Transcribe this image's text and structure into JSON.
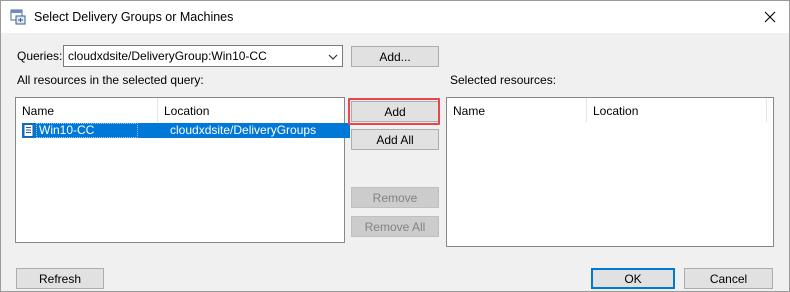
{
  "window": {
    "title": "Select Delivery Groups or Machines"
  },
  "queries": {
    "label": "Queries:",
    "selected": "cloudxdsite/DeliveryGroup:Win10-CC",
    "add_button": "Add..."
  },
  "left_panel": {
    "label": "All resources in the selected query:",
    "columns": [
      "Name",
      "Location"
    ],
    "rows": [
      {
        "name": "Win10-CC",
        "location": "cloudxdsite/DeliveryGroups",
        "selected": true
      }
    ]
  },
  "right_panel": {
    "label": "Selected resources:",
    "columns": [
      "Name",
      "Location"
    ],
    "rows": []
  },
  "middle_buttons": {
    "add": "Add",
    "add_all": "Add All",
    "remove": "Remove",
    "remove_all": "Remove All"
  },
  "footer": {
    "refresh": "Refresh",
    "ok": "OK",
    "cancel": "Cancel"
  },
  "colors": {
    "selection": "#0078d7",
    "highlight_box": "#e8464b",
    "window_bg": "#f0f0f0"
  },
  "icons": [
    "app-window-icon",
    "close-icon",
    "dropdown-arrow-icon",
    "machine-icon"
  ]
}
